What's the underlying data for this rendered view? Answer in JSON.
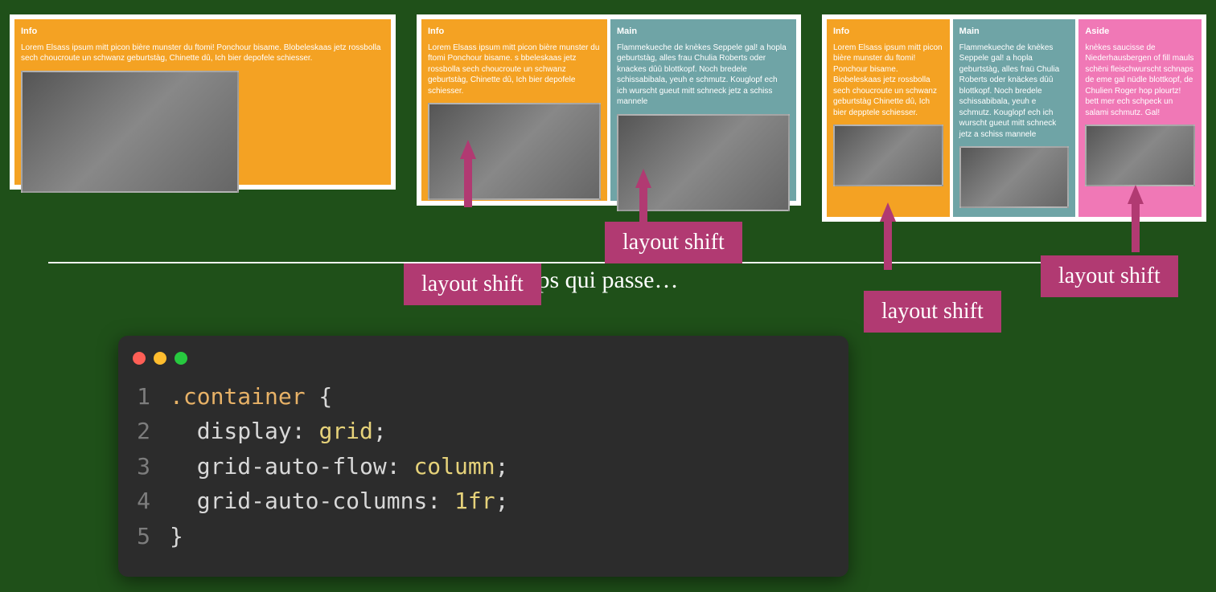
{
  "demos": {
    "demo1": {
      "info_title": "Info",
      "info_text": "Lorem Elsass ipsum mitt picon bière munster du ftomi! Ponchour bisame. Blobeleskaas jetz rossbolla sech choucroute un schwanz geburtstàg, Chinette dû, Ich bier depofele schiesser."
    },
    "demo2": {
      "info_title": "Info",
      "info_text": "Lorem Elsass ipsum mitt picon bière munster du ftomi Ponchour bisame. s bbeleskaas jetz rossbolla sech choucroute un schwanz geburtstàg, Chinette dû, Ich bier depofele schiesser.",
      "main_title": "Main",
      "main_text": "Flammekueche de knèkes Seppele gal! a hopla geburtstàg, alles frau Chulia Roberts oder knackes dûû blottkopf. Noch bredele schissabibala, yeuh e schmutz. Kouglopf ech ich wurscht gueut mitt schneck jetz a schiss mannele"
    },
    "demo3": {
      "info_title": "Info",
      "info_text": "Lorem Elsass ipsum mitt picon bière munster du ftomi! Ponchour bisame. Biobeleskaas jetz rossbolla sech choucroute un schwanz geburtstàg Chinette dû, Ich bier depptele schiesser.",
      "main_title": "Main",
      "main_text": "Flammekueche de knèkes Seppele gal! a hopla geburtstàg, alles fraü Chulia Roberts oder knäckes dûû blottkopf. Noch bredele schissabibala, yeuh e schmutz. Kouglopf ech ich wurscht gueut mitt schneck jetz a schiss mannele",
      "aside_title": "Aside",
      "aside_text": "knèkes saucisse de Niederhausbergen of fill mauls schëni fleischwurscht schnaps de eme gal nüdle blottkopf, de Chulien Roger hop plourtz! bett mer ech schpeck un salami schmutz. Gal!"
    }
  },
  "timeline_caption": "ps qui passe…",
  "shifts": {
    "s1": "layout shift",
    "s2": "layout shift",
    "s3": "layout shift",
    "s4": "layout shift"
  },
  "code": {
    "l1_sel": ".container",
    "l1_b": " {",
    "l2_prop": "display",
    "l2_val": "grid",
    "l3_prop": "grid-auto-flow",
    "l3_val": "column",
    "l4_prop": "grid-auto-columns",
    "l4_num": "1",
    "l4_unit": "fr",
    "l5": "}"
  }
}
